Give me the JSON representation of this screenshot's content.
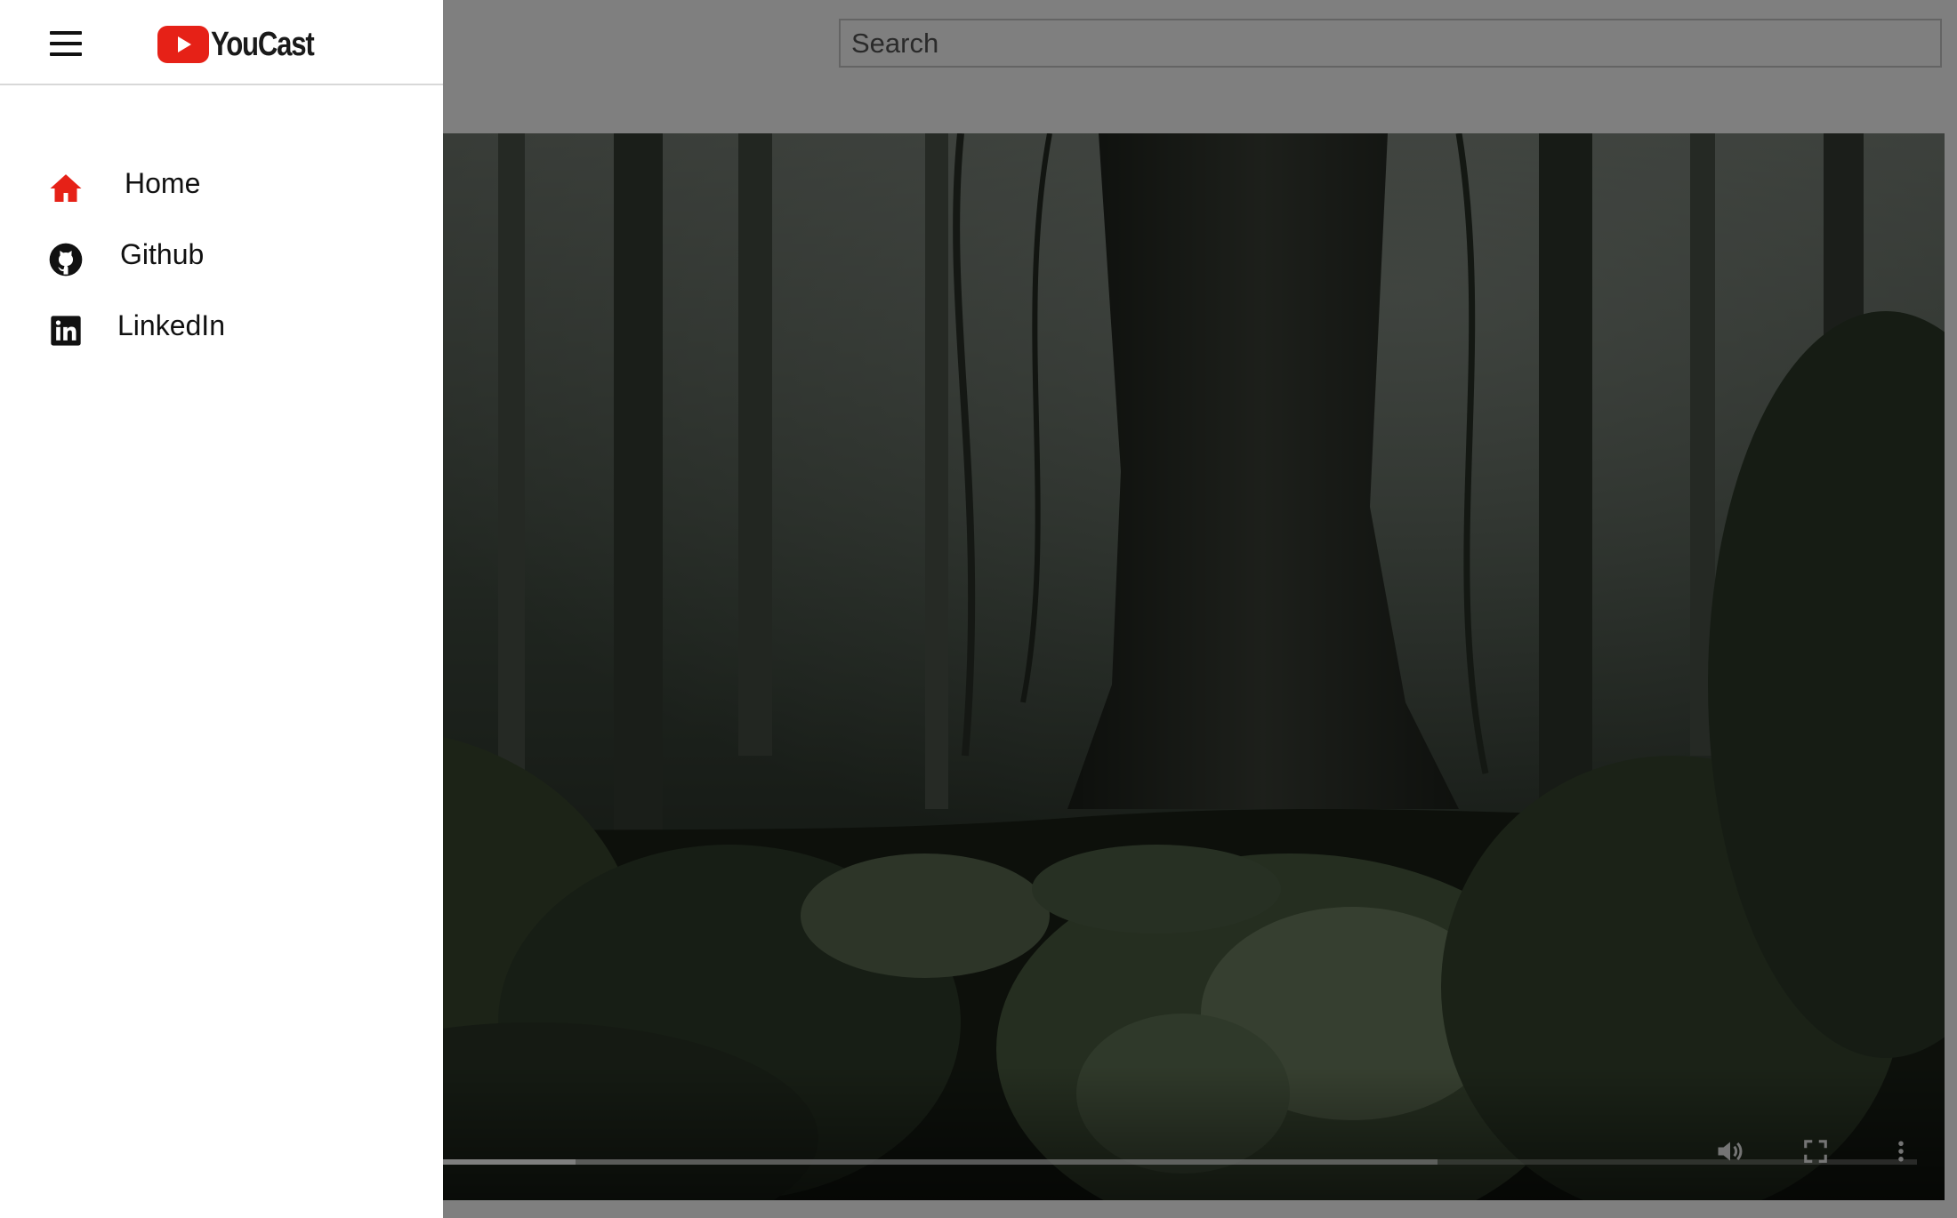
{
  "app": {
    "logo_text": "YouCast",
    "brand_color": "#e62117"
  },
  "search": {
    "placeholder": "Search",
    "value": ""
  },
  "drawer": {
    "open": true,
    "items": [
      {
        "label": "Home",
        "icon": "home-icon",
        "active": true
      },
      {
        "label": "Github",
        "icon": "github-icon",
        "active": false
      },
      {
        "label": "LinkedIn",
        "icon": "linkedin-icon",
        "active": false
      }
    ]
  },
  "player": {
    "scene": "jungle video frame",
    "progress_played": 0.3,
    "progress_buffered": 0.75,
    "controls": [
      "volume-icon",
      "fullscreen-icon",
      "more-options-icon"
    ]
  },
  "colors": {
    "overlay": "rgba(0,0,0,0.5)",
    "home_icon": "#e62117",
    "text": "#111111"
  }
}
